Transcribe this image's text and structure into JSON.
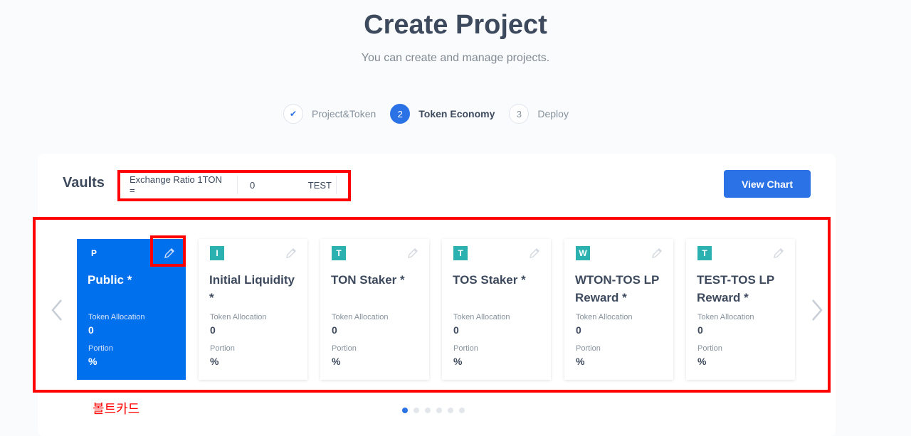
{
  "header": {
    "title": "Create Project",
    "subtitle": "You can create and manage projects."
  },
  "stepper": {
    "steps": [
      {
        "marker": "✔",
        "label": "Project&Token",
        "state": "done"
      },
      {
        "marker": "2",
        "label": "Token Economy",
        "state": "active"
      },
      {
        "marker": "3",
        "label": "Deploy",
        "state": "pending"
      }
    ]
  },
  "vaults": {
    "title": "Vaults",
    "exchange_ratio_label": "Exchange Ratio 1TON =",
    "exchange_ratio_value": "0",
    "exchange_ratio_unit": "TEST",
    "view_chart_label": "View Chart"
  },
  "carousel": {
    "prev_icon": "chevron-left-icon",
    "next_icon": "chevron-right-icon",
    "cards": [
      {
        "badge": "P",
        "name": "Public *",
        "allocation_label": "Token Allocation",
        "allocation_value": "0",
        "portion_label": "Portion",
        "portion_value": "%",
        "active": true
      },
      {
        "badge": "I",
        "name": "Initial Liquidity *",
        "allocation_label": "Token Allocation",
        "allocation_value": "0",
        "portion_label": "Portion",
        "portion_value": "%",
        "active": false
      },
      {
        "badge": "T",
        "name": "TON Staker *",
        "allocation_label": "Token Allocation",
        "allocation_value": "0",
        "portion_label": "Portion",
        "portion_value": "%",
        "active": false
      },
      {
        "badge": "T",
        "name": "TOS Staker *",
        "allocation_label": "Token Allocation",
        "allocation_value": "0",
        "portion_label": "Portion",
        "portion_value": "%",
        "active": false
      },
      {
        "badge": "W",
        "name": "WTON-TOS LP Reward *",
        "allocation_label": "Token Allocation",
        "allocation_value": "0",
        "portion_label": "Portion",
        "portion_value": "%",
        "active": false
      },
      {
        "badge": "T",
        "name": "TEST-TOS LP Reward *",
        "allocation_label": "Token Allocation",
        "allocation_value": "0",
        "portion_label": "Portion",
        "portion_value": "%",
        "active": false
      }
    ],
    "page_count": 6,
    "current_page": 1
  },
  "annotation": {
    "text": "볼트카드",
    "color": "#ff0000"
  },
  "colors": {
    "accent": "#2a72e5",
    "active_card": "#0070ed",
    "badge": "#2bb2b0",
    "highlight": "#ff0000"
  }
}
